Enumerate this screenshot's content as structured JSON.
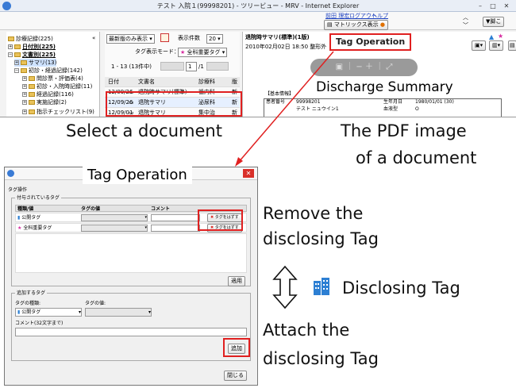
{
  "browser": {
    "title": "テスト 入院１(99998201) - ツリービュー - MRV - Internet Explorer",
    "user_name": "前田 理宏",
    "logout_link": "ログアウト",
    "help_link": "ヘルプ",
    "matrix_button": "マトリックス表示",
    "search_button": "▼脚こ"
  },
  "tree": {
    "root": "診療記録(225)",
    "date_order": "日付別(225)",
    "doc_type": "文書別(225)",
    "summary": "サマリ(13)",
    "sub_records": "初診・経過記録(142)",
    "item1": "問診票・評価表(4)",
    "item2": "初診・入院時記録(11)",
    "item3": "経過記録(116)",
    "item4": "実施記録(2)",
    "item5": "指示チェックリスト(9)"
  },
  "doclist": {
    "display_mode": "最新版のみ表示",
    "display_count_label": "表示件数",
    "display_count": "20",
    "tag_mode_label": "タグ表示モード：",
    "tag_mode_value": "全科重要タグ",
    "range": "1 - 13 (13件中)",
    "page_current": "1",
    "page_total": "/1",
    "columns": [
      "日付",
      "文書名",
      "診療科",
      "版"
    ],
    "rows": [
      {
        "date": "12/09/26",
        "name": "退院時サマリ(標準)",
        "dept": "循内科",
        "ver": "新"
      },
      {
        "date": "12/09/26",
        "name": "退院サマリ",
        "dept": "泌尿科",
        "ver": "新"
      },
      {
        "date": "12/09/01",
        "name": "退院サマリ",
        "dept": "集中治",
        "ver": "新"
      }
    ]
  },
  "pdf": {
    "doc_title": "退院時サマリ(標準)(1版)",
    "doc_meta": "2010年02月02日 18:50 整形外",
    "tag_operation_button": "Tag Operation",
    "heading": "Discharge Summary",
    "basic_info": "【基本情報】",
    "patient_id_label": "患者番号",
    "patient_id": "99998201",
    "patient_name": "テスト ニュウイン1",
    "birth_label": "生年月日",
    "birth_value": "1980/01/01 (30)",
    "blood_label": "血液型",
    "blood_value": "O"
  },
  "annotations": {
    "select_document": "Select a document",
    "pdf_image_line1": "The PDF image",
    "pdf_image_line2": "of a document",
    "remove_line1": "Remove the",
    "remove_line2": "disclosing Tag",
    "disclosing_tag": "Disclosing Tag",
    "attach_line1": "Attach the",
    "attach_line2": "disclosing Tag"
  },
  "dialog": {
    "title": "Tag Operation",
    "section_title": "タグ操作",
    "attached_group": "付与されているタグ",
    "col_type": "種類/値",
    "col_value": "タグの値",
    "col_comment": "コメント",
    "tag_rows": [
      {
        "name": "公開タグ",
        "remove_label": "タグをはずす"
      },
      {
        "name": "全科重要タグ",
        "remove_label": "タグをはずす"
      }
    ],
    "apply_button": "適用",
    "add_group": "追加するタグ",
    "type_label": "タグの種類:",
    "value_label": "タグの値:",
    "type_value": "公開タグ",
    "comment_label": "コメント(32文字まで)",
    "add_button": "追加",
    "close_button": "閉じる"
  },
  "colors": {
    "highlight_red": "#e02020",
    "arrow_red": "#e02020",
    "tag_blue": "#2d7fd3",
    "star_pink": "#d62ba0"
  }
}
